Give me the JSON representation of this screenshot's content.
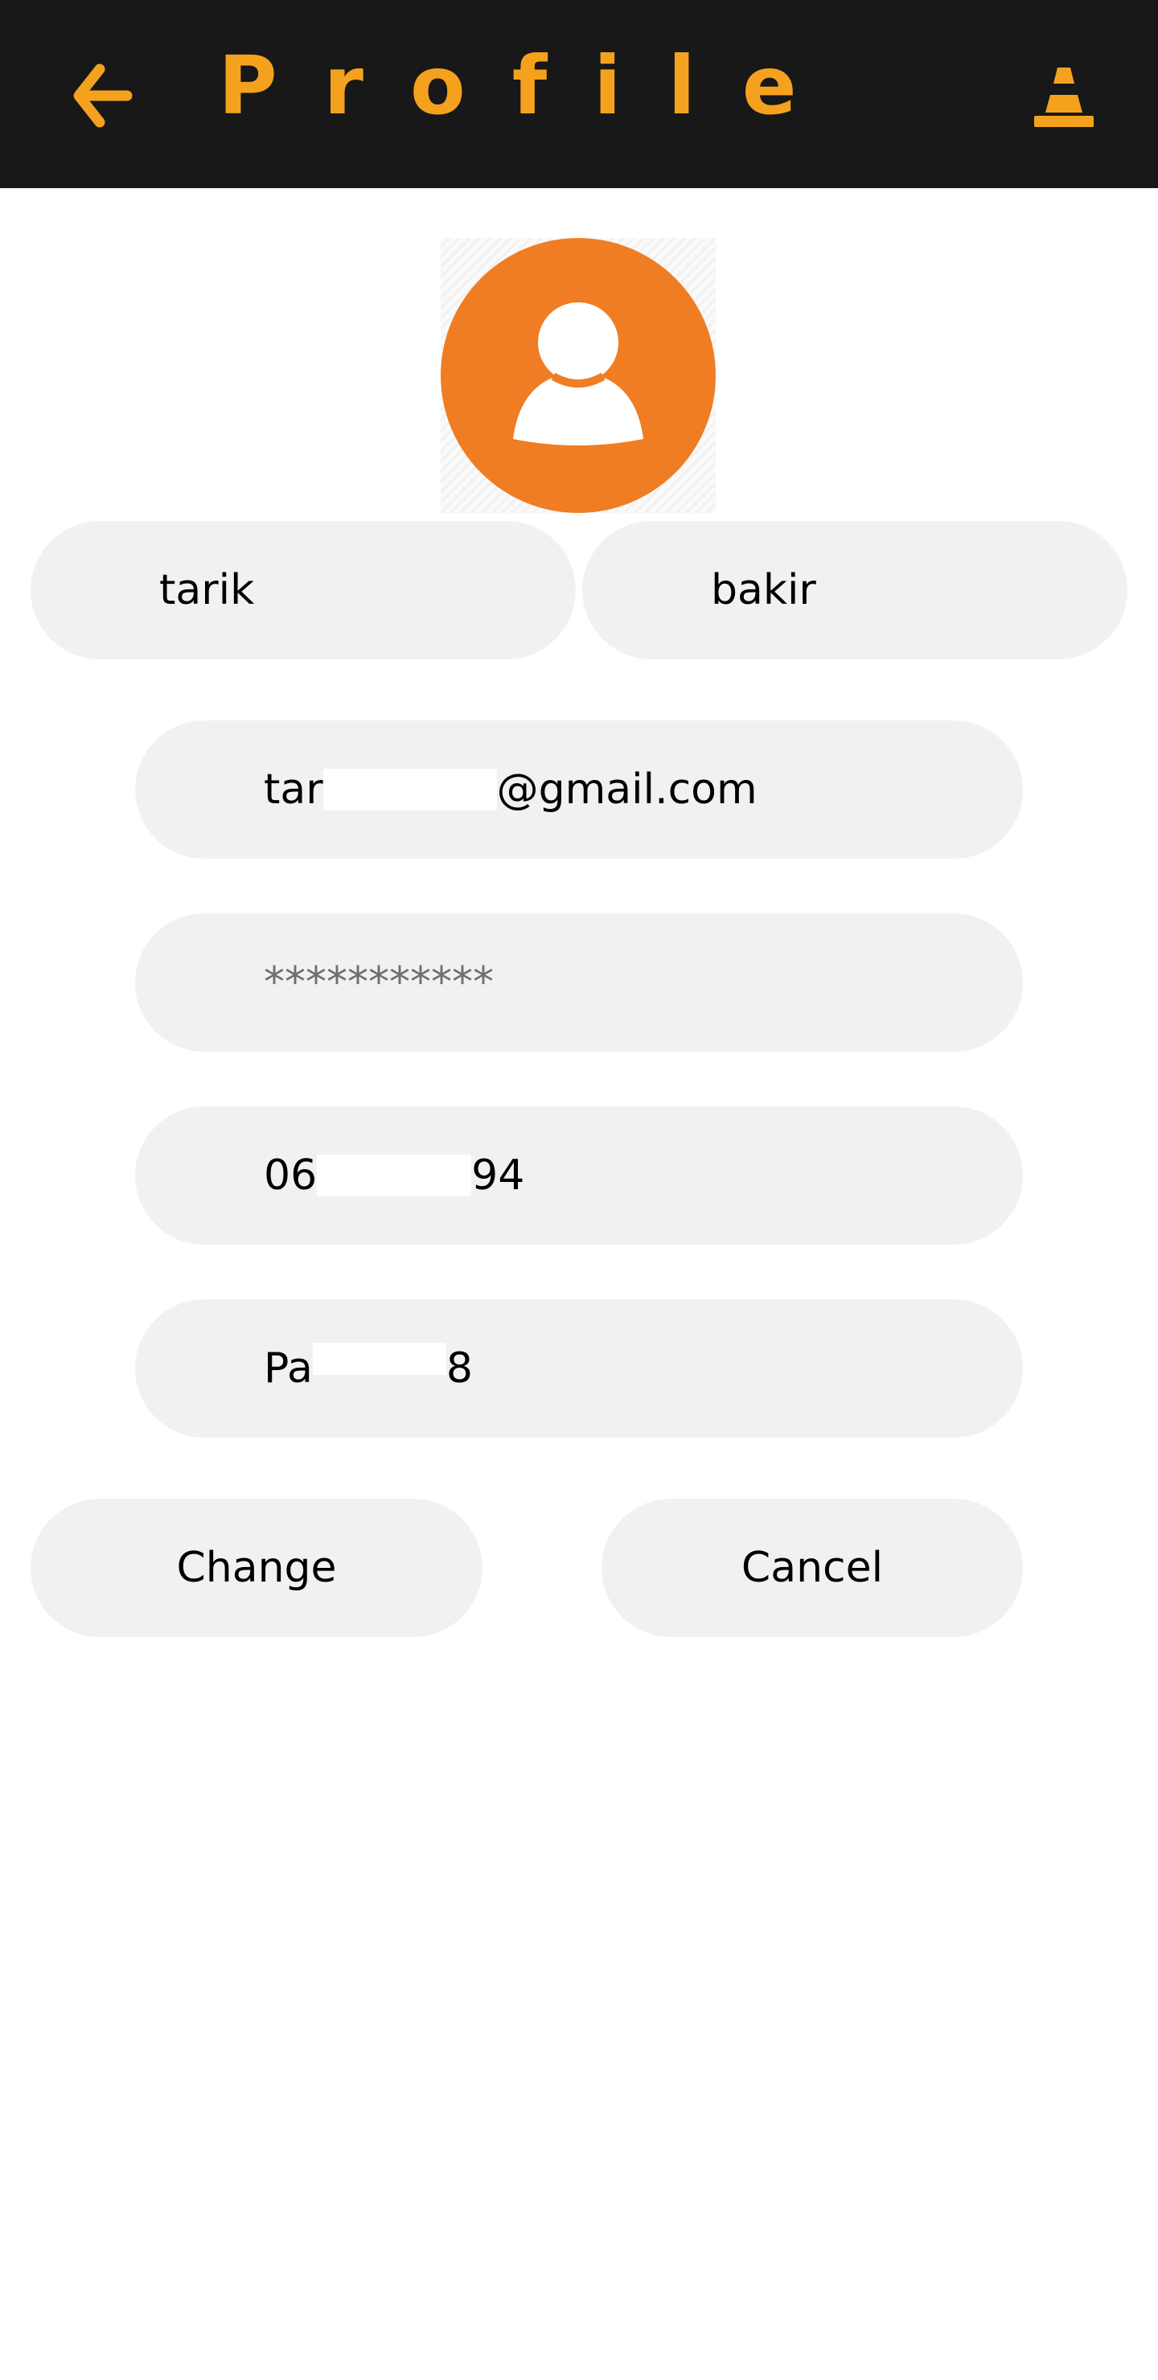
{
  "header": {
    "title": "Profile",
    "back_icon": "arrow-left-icon",
    "right_icon": "traffic-cone-icon",
    "background": "#181818",
    "accent": "#f4a21e"
  },
  "avatar": {
    "icon": "user-avatar-icon",
    "color": "#f07d23"
  },
  "form": {
    "first_name": "tarik",
    "last_name": "bakir",
    "email_prefix": "tar",
    "email_suffix": "@gmail.com",
    "password": "***********",
    "phone_prefix": "06",
    "phone_suffix": "94",
    "address_prefix": "Pa",
    "address_suffix": "8"
  },
  "actions": {
    "change_label": "Change",
    "cancel_label": "Cancel"
  }
}
